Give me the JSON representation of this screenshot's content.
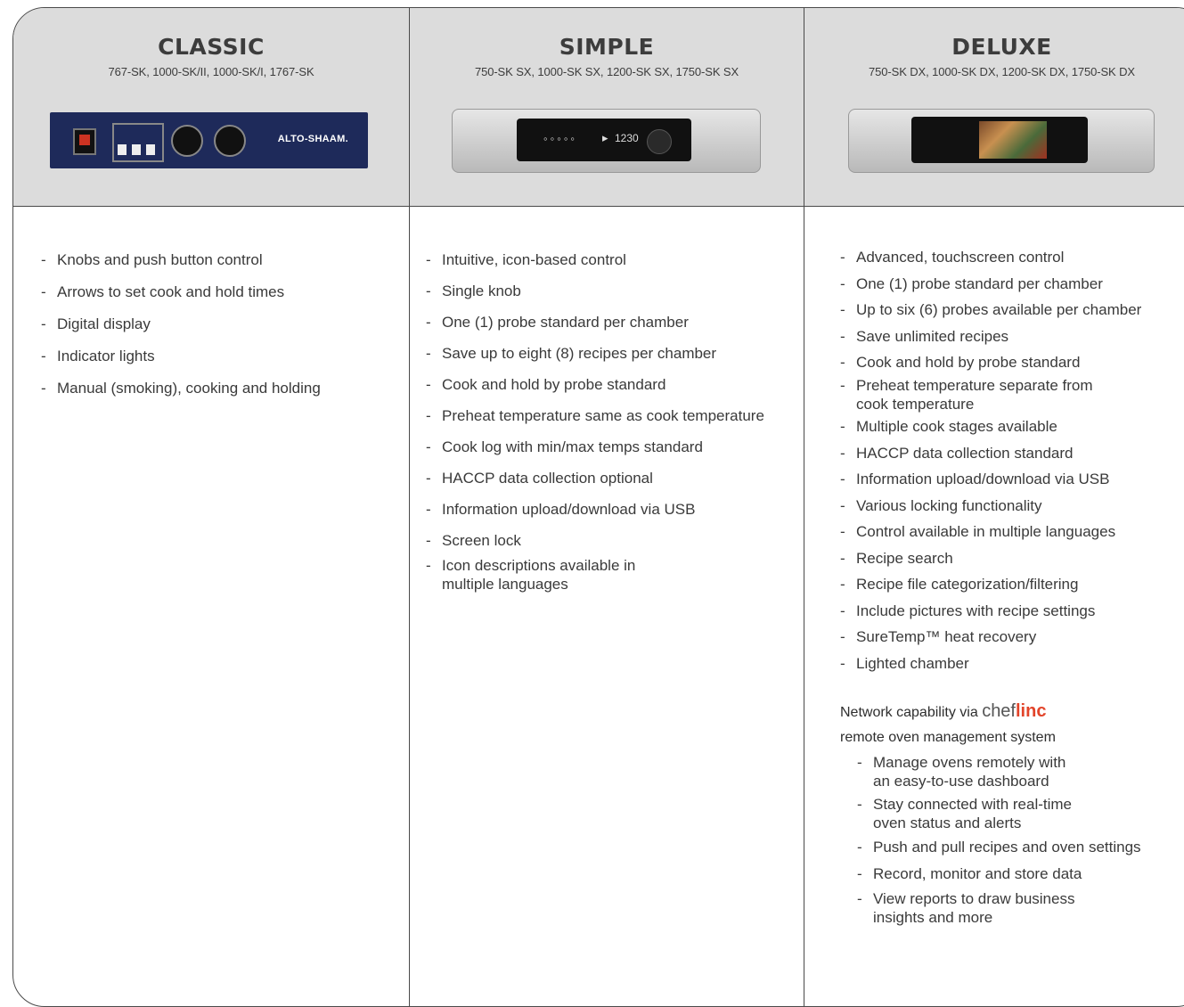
{
  "columns": [
    {
      "title": "CLASSIC",
      "models": "767-SK, 1000-SK/II, 1000-SK/I, 1767-SK",
      "panel_brand": "ALTO-SHAAM.",
      "features": [
        "Knobs and push button control",
        "Arrows to set cook and hold times",
        "Digital display",
        "Indicator lights",
        "Manual (smoking), cooking and holding"
      ]
    },
    {
      "title": "SIMPLE",
      "models": "750-SK SX, 1000-SK SX, 1200-SK SX, 1750-SK SX",
      "panel_readout": "1230",
      "features": [
        "Intuitive, icon-based control",
        "Single knob",
        "One (1) probe standard per chamber",
        "Save up to eight (8) recipes per chamber",
        "Cook and hold by probe standard",
        "Preheat temperature same as cook temperature",
        "Cook log with min/max temps standard",
        "HACCP data collection optional",
        "Information upload/download via USB",
        "Screen lock",
        "Icon descriptions available in\nmultiple languages"
      ]
    },
    {
      "title": "DELUXE",
      "models": "750-SK DX, 1000-SK DX, 1200-SK DX, 1750-SK DX",
      "features": [
        "Advanced, touchscreen control",
        "One (1) probe standard per chamber",
        "Up to six (6) probes available per chamber",
        "Save unlimited recipes",
        "Cook and hold by probe standard",
        "Preheat temperature separate from\ncook temperature",
        "Multiple cook stages available",
        "HACCP data collection standard",
        "Information upload/download via USB",
        "Various locking functionality",
        "Control available in multiple languages",
        "Recipe search",
        "Recipe file categorization/filtering",
        "Include pictures with recipe settings",
        "SureTemp™ heat recovery",
        "Lighted chamber"
      ],
      "network": {
        "prefix": "Network capability via",
        "logo_chef": "chef",
        "logo_linc": "linc",
        "line2": "remote oven management system",
        "features": [
          "Manage ovens remotely with\nan easy-to-use dashboard",
          "Stay connected with real-time\noven status and alerts",
          "Push and pull recipes and oven settings",
          "Record, monitor and store data",
          "View reports to draw business\ninsights and more"
        ]
      }
    }
  ],
  "colors": {
    "header_bg": "#dcdcdc",
    "border": "#4a4a4a",
    "linc_red": "#e2442a",
    "classic_panel": "#1e2a5a"
  },
  "dash": "-"
}
